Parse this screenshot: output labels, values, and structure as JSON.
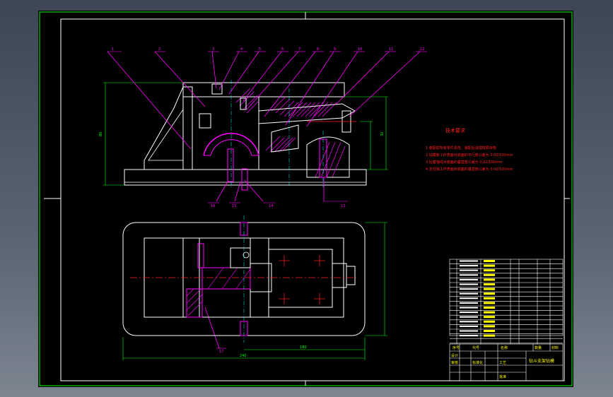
{
  "notes": {
    "title": "技术要求",
    "lines": [
      "1 装配前所有零件清洗，装配后清理铁屑杂物",
      "2 钻模板工作表面对底面的平行度公差为 0.02/100mm",
      "3 钻套轴线对底面的垂直度公差为 0.02/100mm",
      "4 定位销工作表面对底面的垂直度公差为 0.02/100mm"
    ]
  },
  "balloons_top": [
    "1",
    "2",
    "3",
    "4",
    "5",
    "6",
    "7",
    "8",
    "9",
    "10",
    "11",
    "12"
  ],
  "balloons_bottom": [
    "16",
    "15",
    "14",
    "13"
  ],
  "balloon_plan": "17",
  "dims": {
    "height_left": "80",
    "height_right": "32",
    "width_plan": "240",
    "width_plan2": "180"
  },
  "title_block": {
    "drawing_title": "钻斗支架钻模",
    "labels": [
      "设计",
      "审核",
      "标准化",
      "工艺",
      "批准"
    ],
    "col_headers": [
      "序号",
      "代号",
      "名称",
      "数量",
      "材料",
      "备注"
    ]
  },
  "colors": {
    "outline": "#ffffff",
    "green": "#00ff00",
    "magenta": "#ff00ff",
    "red": "#ff2020",
    "yellow": "#ffff00",
    "cyan": "#00ffff"
  }
}
